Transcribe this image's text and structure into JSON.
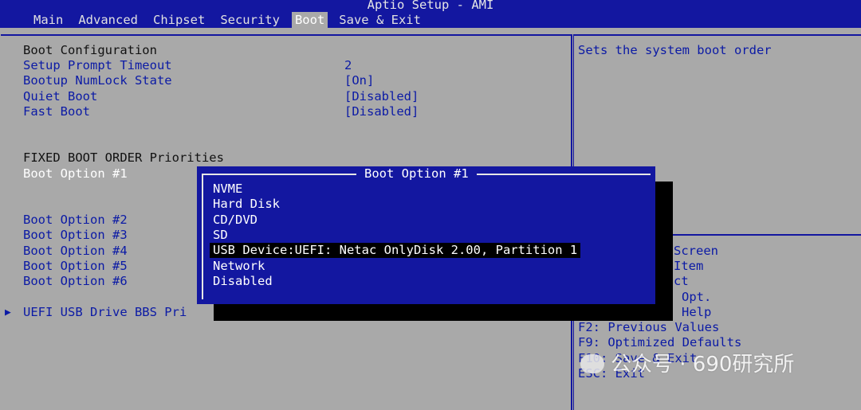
{
  "header": {
    "title": "Aptio Setup - AMI",
    "tabs": [
      "Main",
      "Advanced",
      "Chipset",
      "Security",
      "Boot",
      "Save & Exit"
    ],
    "active_tab": "Boot"
  },
  "boot": {
    "section_title": "Boot Configuration",
    "settings": [
      {
        "label": "Setup Prompt Timeout",
        "value": "2"
      },
      {
        "label": "Bootup NumLock State",
        "value": "[On]"
      },
      {
        "label": "Quiet Boot",
        "value": "[Disabled]"
      },
      {
        "label": "Fast Boot",
        "value": "[Disabled]"
      }
    ],
    "priorities_title": "FIXED BOOT ORDER Priorities",
    "options": [
      "Boot Option #1",
      "Boot Option #2",
      "Boot Option #3",
      "Boot Option #4",
      "Boot Option #5",
      "Boot Option #6"
    ],
    "submenu_label": "UEFI USB Drive BBS Pri",
    "submenu_arrow": "▶"
  },
  "popup": {
    "title": "Boot Option #1",
    "items": [
      "NVME",
      "Hard Disk",
      "CD/DVD",
      "SD",
      "USB Device:UEFI: Netac OnlyDisk 2.00, Partition 1",
      "Network",
      "Disabled"
    ],
    "selected_index": 4
  },
  "help": {
    "description": "Sets the system boot order",
    "keys_partial": [
      "Screen",
      "Item",
      "ct",
      "Opt.",
      "Help"
    ],
    "keys_full": [
      "F2: Previous Values",
      "F9: Optimized Defaults",
      "F10: Save & Exit",
      "ESC: Exit"
    ]
  },
  "watermark": {
    "text": "公众号 · 690研究所"
  },
  "colors": {
    "bios_blue": "#1317a0",
    "panel_gray": "#a9a9a9",
    "text_blue": "#0b1aa5",
    "selected_bg": "#000000"
  }
}
